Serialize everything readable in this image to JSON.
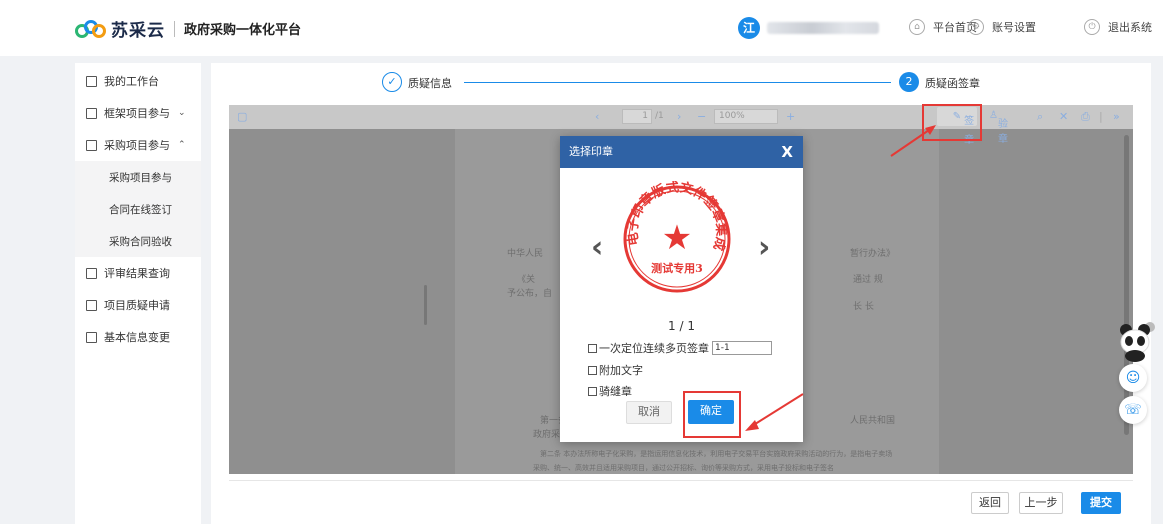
{
  "header": {
    "brand": "苏采云",
    "platform": "政府采购一体化平台",
    "avatar_text": "江",
    "nav": [
      {
        "label": "平台首页",
        "icon": "home-icon"
      },
      {
        "label": "账号设置",
        "icon": "gear-icon"
      },
      {
        "label": "退出系统",
        "icon": "power-icon"
      }
    ]
  },
  "sidebar": {
    "items": [
      {
        "label": "我的工作台"
      },
      {
        "label": "框架项目参与",
        "arrow": "⌄"
      },
      {
        "label": "采购项目参与",
        "arrow": "⌃"
      },
      {
        "label": "采购项目参与"
      },
      {
        "label": "合同在线签订"
      },
      {
        "label": "采购合同验收"
      },
      {
        "label": "评审结果查询"
      },
      {
        "label": "项目质疑申请"
      },
      {
        "label": "基本信息变更"
      }
    ]
  },
  "steps": {
    "step1": {
      "check": "✓",
      "label": "质疑信息"
    },
    "step2": {
      "number": "2",
      "label": "质疑函签章"
    }
  },
  "pdf_toolbar": {
    "page_value": "1",
    "page_total": "/1",
    "zoom": "100%",
    "sign": "签章",
    "verify": "验章"
  },
  "pdf_page": {
    "line1_left": "中华人民",
    "line1_right": "暂行办法》",
    "line2_left": "《关",
    "line2_right": "通过  规",
    "line3_left": "予公布，自",
    "line3_right": "长  长",
    "clause1": "第一条",
    "clause1_right": "人民共和国",
    "clause1_b": "政府采购法",
    "clause2": "第二条  本办法所称电子化采购，是指运用信息化技术，利用电子交易平台实施政府采购活动的行为，是指电子卖场",
    "clause3": "采购、统一、高效并且适用采购项目，通过公开招标、询价等采购方式，采用电子投标和电子签名"
  },
  "modal": {
    "title": "选择印章",
    "close": "X",
    "prev": "‹",
    "next": "›",
    "seal": {
      "ring_text": "电子印章版式文件签章集成",
      "bottom_text": "测试专用3",
      "star": "★",
      "color": "#e53935"
    },
    "pager": "1 / 1",
    "options": [
      {
        "label": "一次定位连续多页签章",
        "range": "1-1"
      },
      {
        "label": "附加文字"
      },
      {
        "label": "骑缝章"
      }
    ],
    "cancel": "取消",
    "confirm": "确定"
  },
  "footer": {
    "back": "返回",
    "prev": "上一步",
    "submit": "提交"
  },
  "colors": {
    "primary": "#1a8be8",
    "modal_header": "#2f62a5",
    "highlight": "#e53935"
  }
}
